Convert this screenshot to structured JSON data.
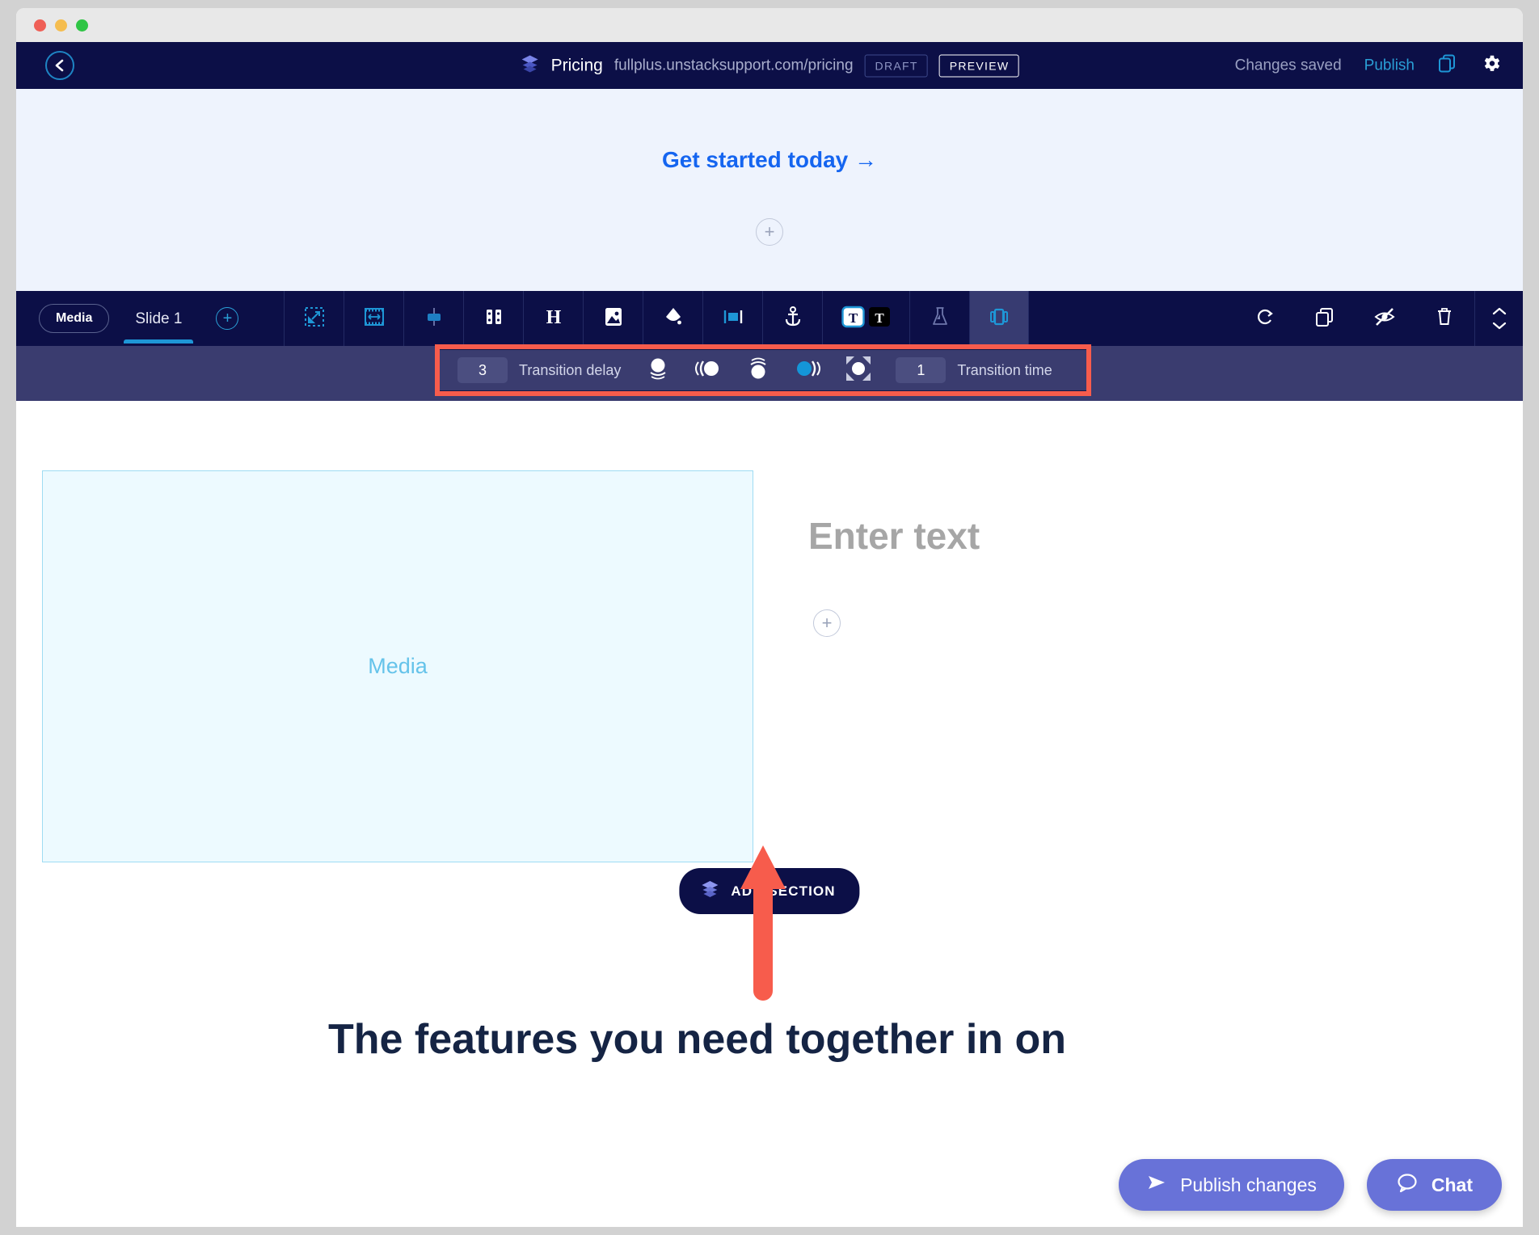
{
  "window": {
    "traffic_lights": [
      "close",
      "minimize",
      "maximize"
    ]
  },
  "header": {
    "back_icon": "chevron-left-icon",
    "logo_icon": "layers-icon",
    "page_title": "Pricing",
    "page_url": "fullplus.unstacksupport.com/pricing",
    "status_badge": "DRAFT",
    "preview_badge": "PREVIEW",
    "save_status": "Changes saved",
    "publish_label": "Publish",
    "devices_icon": "devices-copy-icon",
    "settings_icon": "gear-icon"
  },
  "preview_top": {
    "cta_text": "Get started today →",
    "add_block_icon": "plus-circle-icon"
  },
  "toolbar": {
    "media_chip": "Media",
    "slide_tab": "Slide 1",
    "add_slide_icon": "plus-circle-icon",
    "icons": [
      {
        "name": "resize-handle-icon",
        "title": "Resize"
      },
      {
        "name": "width-icon",
        "title": "Width"
      },
      {
        "name": "align-icon",
        "title": "Align"
      },
      {
        "name": "columns-icon",
        "title": "Columns"
      },
      {
        "name": "heading-icon",
        "title": "Heading"
      },
      {
        "name": "image-icon",
        "title": "Image"
      },
      {
        "name": "fill-color-icon",
        "title": "Background color"
      },
      {
        "name": "banner-icon",
        "title": "Banner"
      },
      {
        "name": "anchor-icon",
        "title": "Anchor"
      },
      {
        "name": "text-color-icon",
        "title": "Text color"
      },
      {
        "name": "flask-icon",
        "title": "Experiment"
      },
      {
        "name": "carousel-icon",
        "title": "Carousel",
        "active": true
      }
    ],
    "right_icons": [
      {
        "name": "refresh-icon",
        "title": "Replace"
      },
      {
        "name": "duplicate-icon",
        "title": "Duplicate"
      },
      {
        "name": "hide-icon",
        "title": "Hide"
      },
      {
        "name": "trash-icon",
        "title": "Delete"
      },
      {
        "name": "move-updown-icon",
        "title": "Move"
      }
    ]
  },
  "transition_bar": {
    "delay_value": "3",
    "delay_label": "Transition delay",
    "time_value": "1",
    "time_label": "Transition time",
    "highlight_color": "#f75c4c",
    "accent_color": "#1e96d6",
    "transition_icons": [
      {
        "name": "transition-fade-up-icon",
        "selected": false
      },
      {
        "name": "transition-slide-left-icon",
        "selected": false
      },
      {
        "name": "transition-fade-down-icon",
        "selected": false
      },
      {
        "name": "transition-slide-right-icon",
        "selected": true
      },
      {
        "name": "transition-zoom-icon",
        "selected": false
      }
    ]
  },
  "canvas": {
    "media_placeholder": "Media",
    "text_placeholder": "Enter text",
    "add_block_icon": "plus-circle-icon",
    "add_section_label": "ADD SECTION",
    "add_section_icon": "layers-icon",
    "bottom_heading_prefix": "The ",
    "bottom_heading_highlight": "features you need",
    "bottom_heading_suffix": " together in on"
  },
  "floating": {
    "publish_changes_label": "Publish changes",
    "publish_icon": "send-icon",
    "chat_label": "Chat",
    "chat_icon": "chat-bubble-icon"
  },
  "annotation": {
    "arrow_icon": "up-arrow-annotation",
    "arrow_color": "#f75c4c"
  }
}
